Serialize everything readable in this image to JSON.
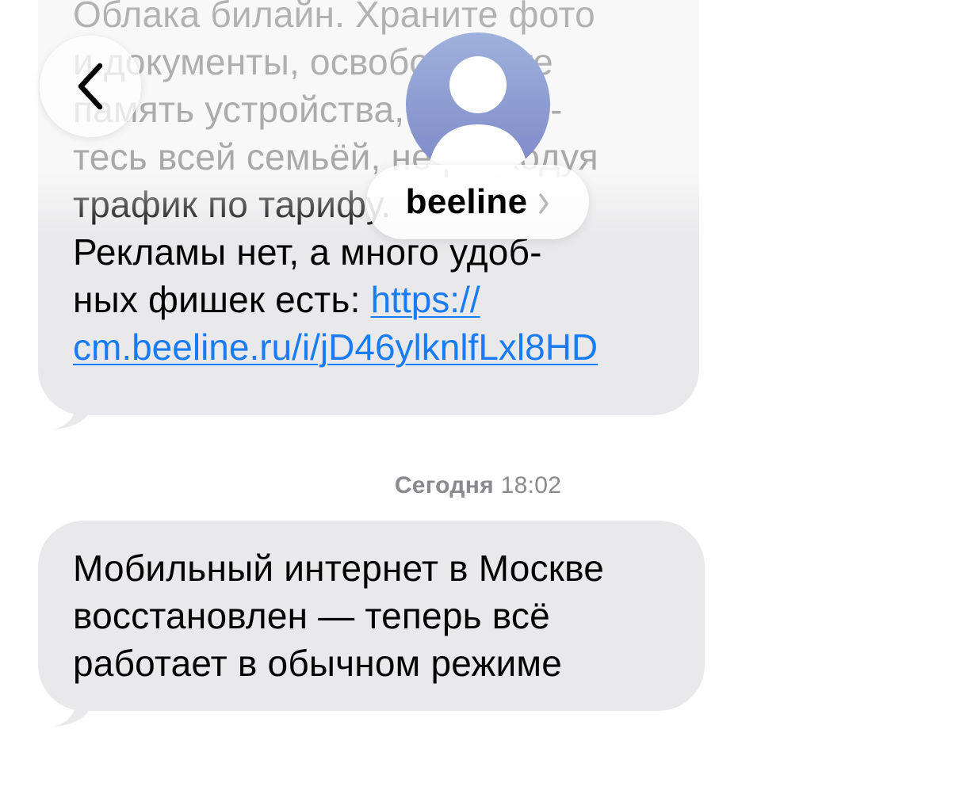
{
  "header": {
    "back_icon": "chevron-left-icon",
    "avatar_icon": "person-silhouette-icon",
    "contact_name": "beeline",
    "contact_chevron_icon": "chevron-right-icon"
  },
  "messages": [
    {
      "text_lines": "Облака билайн. Храните фото\nи документы, освобождайте\nпамять устройства, пользуй-\nтесь всей семьёй, не расходуя\nтрафик по тарифу.\nРекламы нет, а много удоб-\nных фишек есть: ",
      "link_part_1": "https://",
      "link_part_2": "cm.beeline.ru/i/jD46ylknlfLxl8HD"
    },
    {
      "text_lines": "Мобильный интернет в Москве\nвосстановлен — теперь всё\nработает в обычном режиме"
    }
  ],
  "timestamp": {
    "day": "Сегодня",
    "time": "18:02"
  },
  "colors": {
    "bubble": "#e9e9eb",
    "link": "#1a7cf5",
    "timestamp": "#8a8a8e",
    "avatar_top": "#9fb1dc",
    "avatar_bottom": "#7c88c6"
  }
}
